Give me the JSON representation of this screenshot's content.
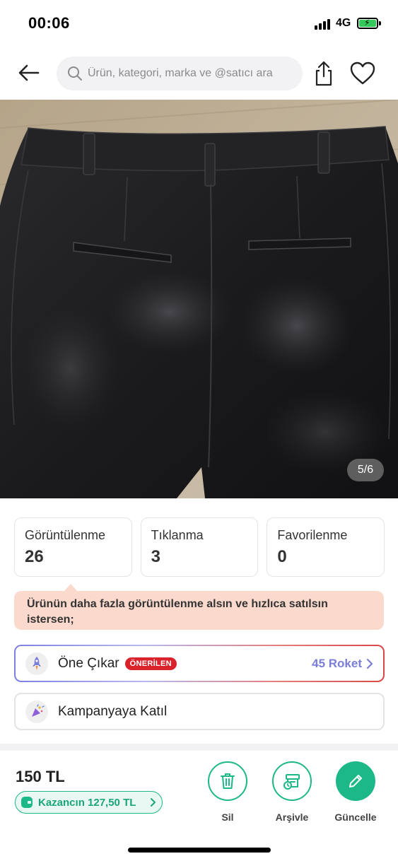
{
  "status_bar": {
    "time": "00:06",
    "network": "4G"
  },
  "header": {
    "search_placeholder": "Ürün, kategori, marka ve @satıcı ara"
  },
  "image": {
    "counter": "5/6"
  },
  "stats": [
    {
      "label": "Görüntülenme",
      "value": "26"
    },
    {
      "label": "Tıklanma",
      "value": "3"
    },
    {
      "label": "Favorilenme",
      "value": "0"
    }
  ],
  "tip": {
    "text": "Ürünün daha fazla görüntülenme alsın ve hızlıca satılsın istersen;"
  },
  "options": {
    "highlight": {
      "label": "Öne Çıkar",
      "badge": "ÖNERİLEN",
      "cost": "45 Roket"
    },
    "campaign": {
      "label": "Kampanyaya Katıl"
    }
  },
  "bottom": {
    "price": "150 TL",
    "earning": "Kazancın 127,50 TL",
    "actions": {
      "delete": "Sil",
      "archive": "Arşivle",
      "update": "Güncelle"
    }
  },
  "colors": {
    "accent_green": "#1db887",
    "badge_red": "#d9222a",
    "roket_purple": "#7b7ed6",
    "tip_bg": "#fbdacd"
  }
}
